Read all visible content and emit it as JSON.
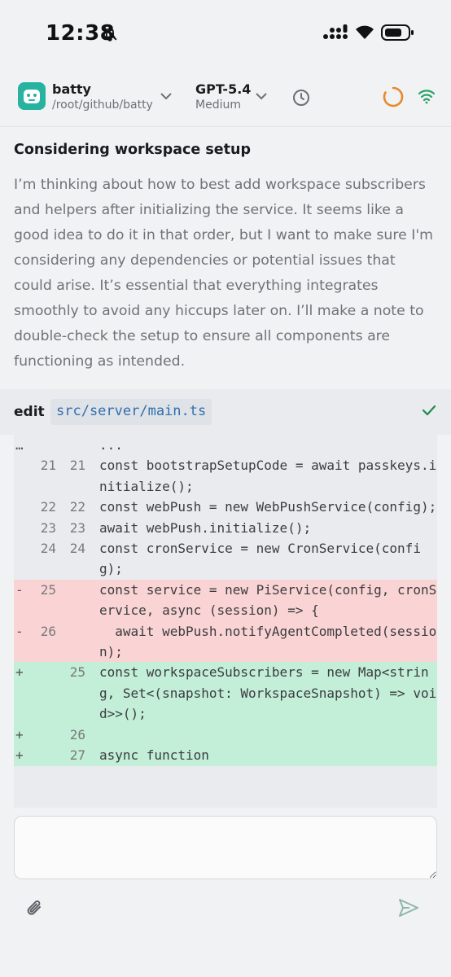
{
  "status_bar": {
    "time": "12:38"
  },
  "header": {
    "project_name": "batty",
    "project_path": "/root/github/batty",
    "model_name": "GPT-5.4",
    "model_level": "Medium",
    "icons": [
      "bot-icon",
      "chevron-down-icon",
      "history-icon",
      "spinner-icon",
      "wifi-icon"
    ],
    "accent": "#e8892b",
    "connected_color": "#27a36a"
  },
  "thinking": {
    "title": "Considering workspace setup",
    "lines": [
      "I’m thinking about how to best add workspace subscribers",
      "and helpers after initializing the service. It seems like a",
      "good idea to do it in that order, but I want to make sure I'm",
      "considering any dependencies or potential issues that",
      "could arise. It’s essential that everything integrates",
      "smoothly to avoid any hiccups later on. I’ll make a note to",
      "double-check the setup to ensure all components are",
      "functioning as intended."
    ]
  },
  "edit": {
    "label": "edit",
    "path": "src/server/main.ts",
    "lines": [
      {
        "type": "ctx",
        "marker": "…",
        "old": "",
        "new": "",
        "code": "..."
      },
      {
        "type": "ctx",
        "marker": "",
        "old": "21",
        "new": "21",
        "code": "const bootstrapSetupCode = await passkeys.initialize();"
      },
      {
        "type": "ctx",
        "marker": "",
        "old": "22",
        "new": "22",
        "code": "const webPush = new WebPushService(config);"
      },
      {
        "type": "ctx",
        "marker": "",
        "old": "23",
        "new": "23",
        "code": "await webPush.initialize();"
      },
      {
        "type": "ctx",
        "marker": "",
        "old": "24",
        "new": "24",
        "code": "const cronService = new CronService(config);"
      },
      {
        "type": "del",
        "marker": "-",
        "old": "25",
        "new": "",
        "code": "const service = new PiService(config, cronService, async (session) => {"
      },
      {
        "type": "del",
        "marker": "-",
        "old": "26",
        "new": "",
        "code": "  await webPush.notifyAgentCompleted(session);"
      },
      {
        "type": "add",
        "marker": "+",
        "old": "",
        "new": "25",
        "code": "const workspaceSubscribers = new Map<string, Set<(snapshot: WorkspaceSnapshot) => void>>();"
      },
      {
        "type": "add",
        "marker": "+",
        "old": "",
        "new": "26",
        "code": " "
      },
      {
        "type": "add",
        "marker": "+",
        "old": "",
        "new": "27",
        "code": "async function"
      }
    ]
  },
  "composer": {
    "placeholder": "",
    "icons": [
      "paperclip-icon",
      "send-icon"
    ]
  }
}
